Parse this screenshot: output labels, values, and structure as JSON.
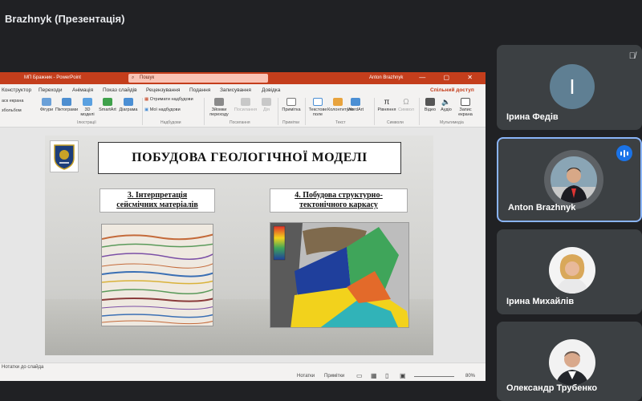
{
  "meet": {
    "presentation_title": "Brazhnyk (Презентація)"
  },
  "powerpoint": {
    "doc_name": "МП Бражник  -  PowerPoint",
    "search_placeholder": "Пошук",
    "user_name": "Anton Brazhnyk",
    "window_controls": "—  ▢  ✕",
    "tabs": [
      "Конструктор",
      "Переходи",
      "Анімація",
      "Показ слайдів",
      "Рецензування",
      "Подання",
      "Записування",
      "Довідка"
    ],
    "share_label": "Спільний доступ",
    "ribbon": {
      "left_items": [
        "аск екрана",
        "збольбом"
      ],
      "buttons": [
        "Фігури",
        "Піктограми",
        "3D моделі",
        "SmartArt",
        "Діаграма",
        "Отримати надбудови",
        "Мої надбудови",
        "Зйомки переходу",
        "Посилання",
        "Дія",
        "Примітка",
        "Текстове поле",
        "Колонтитули",
        "WordArt",
        "Рівняння",
        "Символ",
        "Відео",
        "Аудіо",
        "Запис екрана"
      ],
      "groups": [
        "Ілюстрації",
        "Надбудови",
        "Посилання",
        "Примітки",
        "Текст",
        "Символи",
        "Мультимедіа"
      ]
    },
    "slide": {
      "title": "ПОБУДОВА ГЕОЛОГІЧНОЇ МОДЕЛІ",
      "left_heading_line1": "3. Інтерпретація",
      "left_heading_line2": "сейсмічних матеріалів",
      "right_heading_line1": "4. Побудова структурно-",
      "right_heading_line2": "тектонічного каркасу"
    },
    "notes_label": "Нотатки до слайда",
    "status": {
      "notes_btn": "Нотатки",
      "comments_btn": "Примітки",
      "zoom": "80%"
    }
  },
  "participants": [
    {
      "name": "Ірина Федів",
      "initial": "I",
      "muted": true
    },
    {
      "name": "Anton Brazhnyk",
      "speaking": true
    },
    {
      "name": "Ірина Михайлів"
    },
    {
      "name": "Олександр Трубенко"
    }
  ],
  "colors": {
    "meet_bg": "#202124",
    "tile_bg": "#3c4043",
    "ppt_accent": "#c43e1c",
    "speaking_blue": "#1a73e8"
  }
}
